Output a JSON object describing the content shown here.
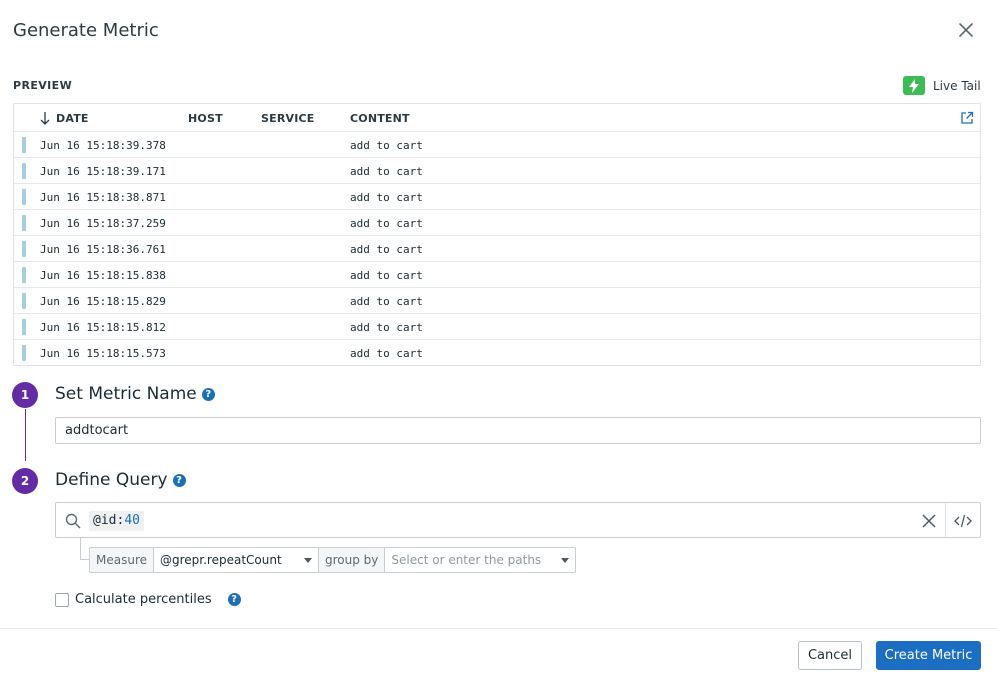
{
  "modal": {
    "title": "Generate Metric"
  },
  "preview": {
    "label": "PREVIEW",
    "live_tail_label": "Live Tail",
    "columns": {
      "date": "DATE",
      "host": "HOST",
      "service": "SERVICE",
      "content": "CONTENT"
    },
    "rows": [
      {
        "date": "Jun 16 15:18:39.378",
        "content": "add to cart"
      },
      {
        "date": "Jun 16 15:18:39.171",
        "content": "add to cart"
      },
      {
        "date": "Jun 16 15:18:38.871",
        "content": "add to cart"
      },
      {
        "date": "Jun 16 15:18:37.259",
        "content": "add to cart"
      },
      {
        "date": "Jun 16 15:18:36.761",
        "content": "add to cart"
      },
      {
        "date": "Jun 16 15:18:15.838",
        "content": "add to cart"
      },
      {
        "date": "Jun 16 15:18:15.829",
        "content": "add to cart"
      },
      {
        "date": "Jun 16 15:18:15.812",
        "content": "add to cart"
      },
      {
        "date": "Jun 16 15:18:15.573",
        "content": "add to cart"
      }
    ]
  },
  "steps": {
    "step1": {
      "number": "1",
      "title": "Set Metric Name",
      "value": "addtocart"
    },
    "step2": {
      "number": "2",
      "title": "Define Query",
      "query_key": "@id:",
      "query_value": "40",
      "measure_label": "Measure",
      "measure_value": "@grepr.repeatCount",
      "group_by_label": "group by",
      "group_by_placeholder": "Select or enter the paths"
    }
  },
  "percentiles": {
    "label": "Calculate percentiles",
    "checked": false
  },
  "footer": {
    "cancel_label": "Cancel",
    "create_label": "Create Metric"
  },
  "colors": {
    "accent": "#632ca6",
    "primary": "#1b6ec2",
    "live_tail": "#3dbc55",
    "log_bar": "#a8cfe0"
  }
}
